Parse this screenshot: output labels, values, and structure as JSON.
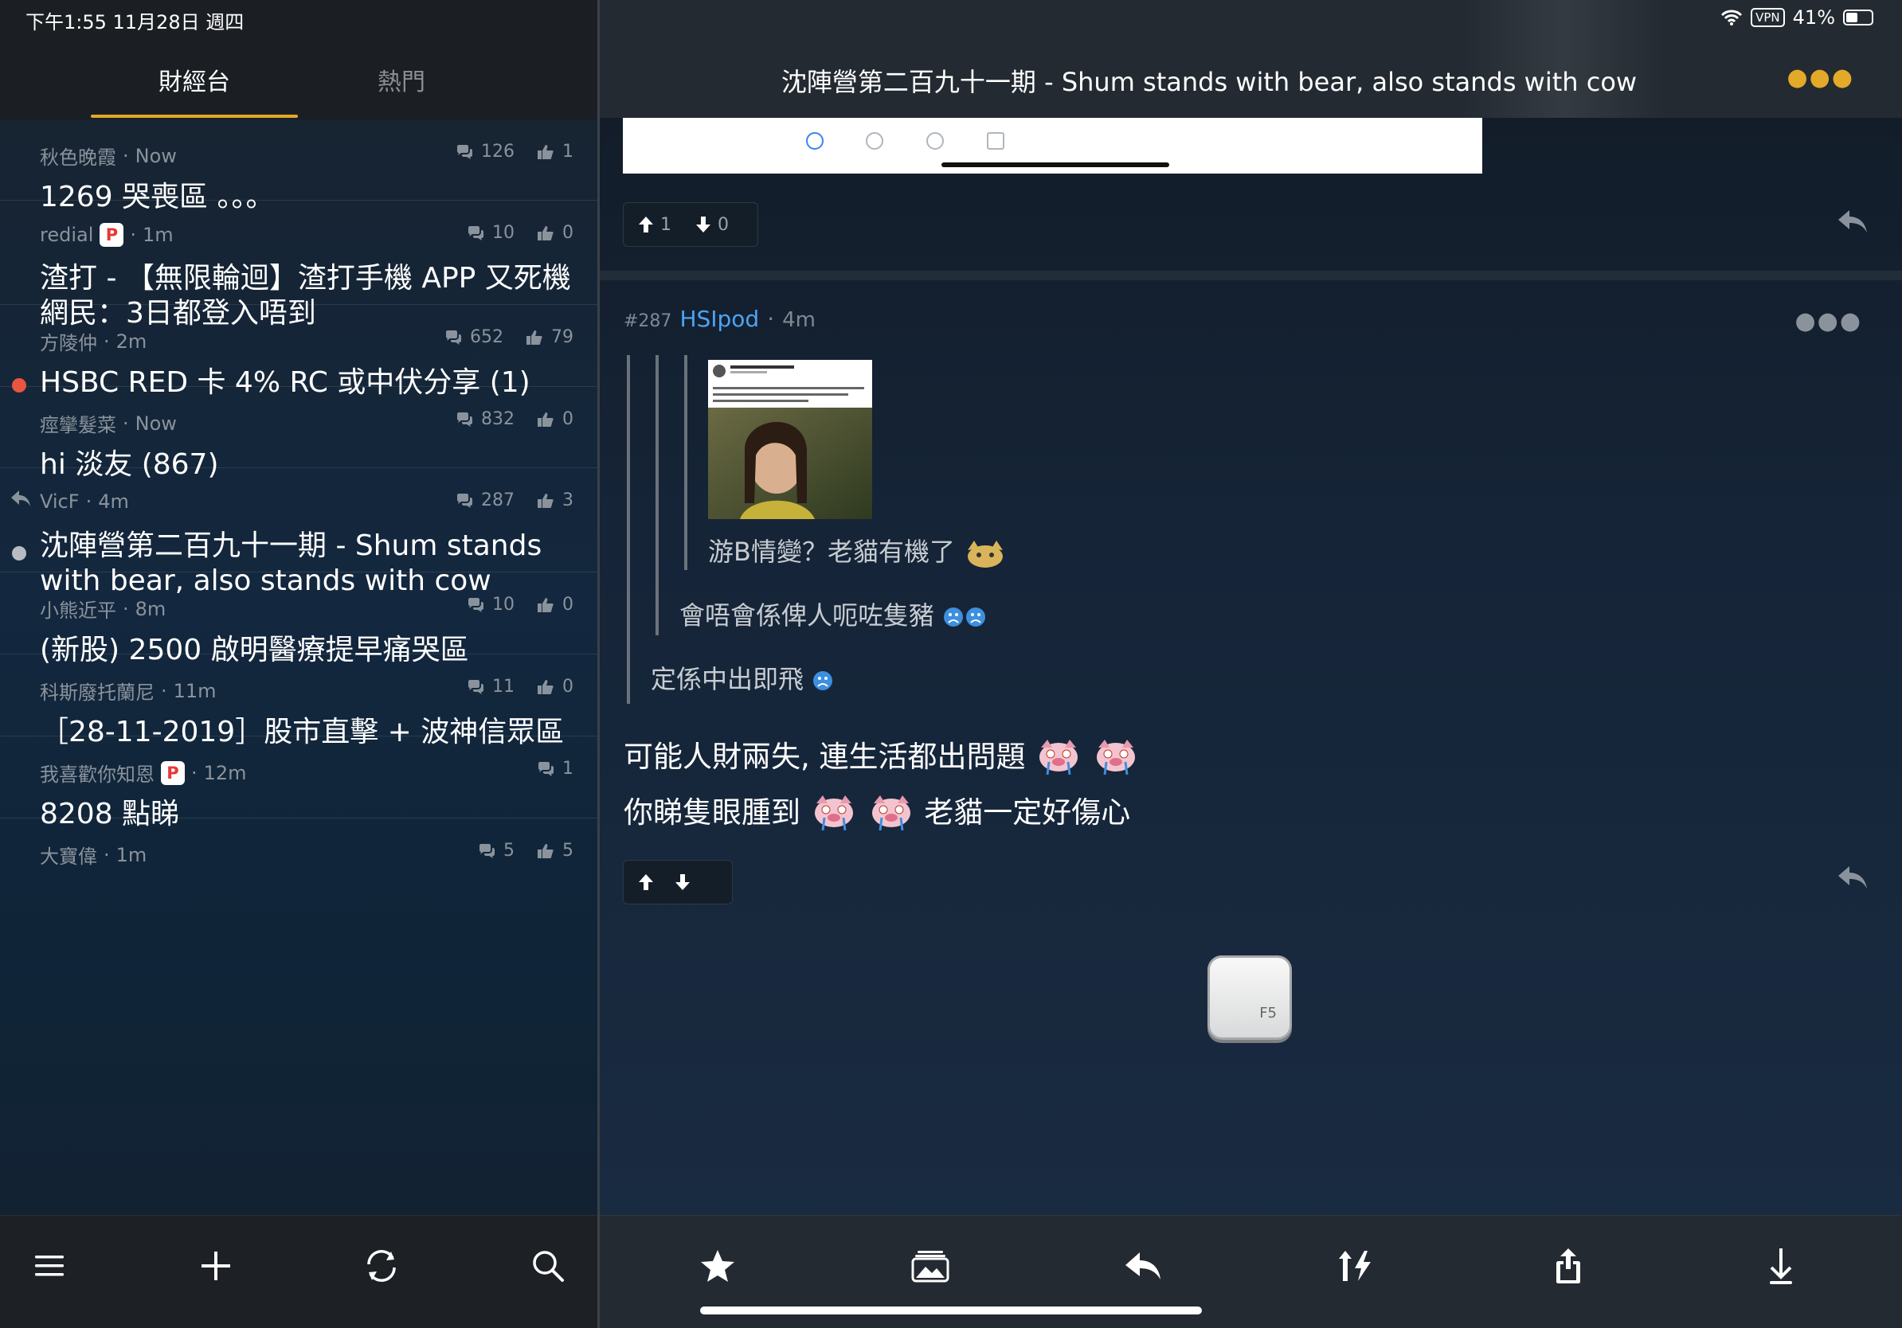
{
  "status_bar": {
    "time_date": "下午1:55 11月28日 週四",
    "vpn": "VPN",
    "battery": "41%"
  },
  "left": {
    "tabs": [
      {
        "label": "財經台",
        "selected": true
      },
      {
        "label": "熱門",
        "selected": false
      }
    ],
    "threads": [
      {
        "author": "秋色晚霞",
        "time": "Now",
        "replies": "126",
        "likes": "1",
        "title": "1269 哭喪區 。。。",
        "badge": ""
      },
      {
        "author": "redial",
        "time": "1m",
        "replies": "10",
        "likes": "0",
        "title": "渣打 - 【無限輪迴】渣打手機 APP 又死機 網民：3日都登入唔到",
        "badge": "P"
      },
      {
        "author": "方陵仲",
        "time": "2m",
        "replies": "652",
        "likes": "79",
        "title": "HSBC RED 卡 4% RC 或中伏分享 (1)",
        "badge": "",
        "dot": "#e9553f"
      },
      {
        "author": "痙攣髮菜",
        "time": "Now",
        "replies": "832",
        "likes": "0",
        "title": "hi 淡友 (867)",
        "badge": ""
      },
      {
        "author": "VicF",
        "time": "4m",
        "replies": "287",
        "likes": "3",
        "title": "沈陣營第二百九十一期 - Shum stands with bear, also stands with cow",
        "badge": "",
        "dot": "#b7bcc2",
        "replied": true
      },
      {
        "author": "小熊近平",
        "time": "8m",
        "replies": "10",
        "likes": "0",
        "title": "(新股) 2500 啟明醫療提早痛哭區",
        "badge": ""
      },
      {
        "author": "科斯廢托蘭尼",
        "time": "11m",
        "replies": "11",
        "likes": "0",
        "title": "［28-11-2019］股市直擊 + 波神信眾區",
        "badge": ""
      },
      {
        "author": "我喜歡你知恩",
        "time": "12m",
        "replies": "1",
        "likes": "",
        "title": "8208 點睇",
        "badge": "P"
      },
      {
        "author": "大寶偉",
        "time": "1m",
        "replies": "5",
        "likes": "5",
        "title": "",
        "badge": ""
      }
    ],
    "toolbar": [
      "menu-icon",
      "plus-icon",
      "refresh-icon",
      "search-icon"
    ]
  },
  "right": {
    "title": "沈陣營第二百九十一期 - Shum stands with bear, also stands with cow",
    "prev_votes": {
      "up": "1",
      "down": "0"
    },
    "post": {
      "number": "#287",
      "author": "HSIpod",
      "time": "4m",
      "quote_inner_text": "游B情變？老貓有機了",
      "quote_mid_text": "會唔會係俾人呃咗隻豬",
      "quote_outer_text": "定係中出即飛",
      "body_line1": "可能人財兩失, 連生活都出問題",
      "body_line2a": "你睇隻眼腫到",
      "body_line2b": "老貓一定好傷心",
      "fb_card_name": "游蕙禎 Yau Wai Ching"
    },
    "f5_label": "F5",
    "toolbar": [
      "star-icon",
      "gallery-icon",
      "reply-icon",
      "sort-icon",
      "share-icon",
      "download-icon"
    ]
  },
  "colors": {
    "accent": "#e3a928",
    "author_link": "#4ea3f0"
  }
}
